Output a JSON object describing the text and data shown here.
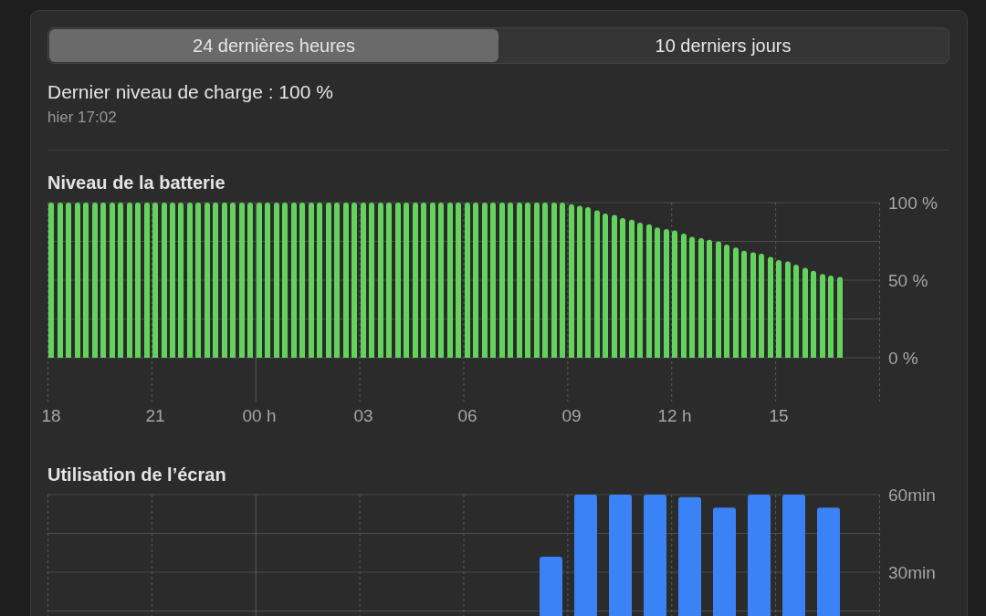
{
  "tabs": [
    {
      "label": "24 dernières heures",
      "selected": true
    },
    {
      "label": "10 derniers jours",
      "selected": false
    }
  ],
  "last_charge": {
    "text": "Dernier niveau de charge : 100 %",
    "time": "hier 17:02"
  },
  "battery": {
    "chart_data": {
      "type": "bar",
      "title": "Niveau de la batterie",
      "ylim": [
        0,
        100
      ],
      "categories": [
        "18",
        null,
        null,
        null,
        null,
        null,
        null,
        null,
        null,
        null,
        null,
        null,
        "21",
        null,
        null,
        null,
        null,
        null,
        null,
        null,
        null,
        null,
        null,
        null,
        "00 h",
        null,
        null,
        null,
        null,
        null,
        null,
        null,
        null,
        null,
        null,
        null,
        "03",
        null,
        null,
        null,
        null,
        null,
        null,
        null,
        null,
        null,
        null,
        null,
        "06",
        null,
        null,
        null,
        null,
        null,
        null,
        null,
        null,
        null,
        null,
        null,
        "09",
        null,
        null,
        null,
        null,
        null,
        null,
        null,
        null,
        null,
        null,
        null,
        "12 h",
        null,
        null,
        null,
        null,
        null,
        null,
        null,
        null,
        null,
        null,
        null,
        "15",
        null,
        null,
        null,
        null,
        null,
        null,
        null
      ],
      "series": [
        {
          "color": "#64d35e",
          "values": [
            100,
            100,
            100,
            100,
            100,
            100,
            100,
            100,
            100,
            100,
            100,
            100,
            100,
            100,
            100,
            100,
            100,
            100,
            100,
            100,
            100,
            100,
            100,
            100,
            100,
            100,
            100,
            100,
            100,
            100,
            100,
            100,
            100,
            100,
            100,
            100,
            100,
            100,
            100,
            100,
            100,
            100,
            100,
            100,
            100,
            100,
            100,
            100,
            100,
            100,
            100,
            100,
            100,
            100,
            100,
            100,
            100,
            100,
            100,
            100,
            99,
            98,
            97,
            95,
            93,
            92,
            90,
            89,
            87,
            86,
            84,
            83,
            82,
            80,
            78,
            77,
            76,
            75,
            73,
            71,
            69,
            68,
            67,
            65,
            63,
            62,
            60,
            58,
            56,
            54,
            53,
            52
          ]
        }
      ],
      "yticks": [
        {
          "value": 0,
          "label": "0 %"
        },
        {
          "value": 50,
          "label": "50 %"
        },
        {
          "value": 100,
          "label": "100 %"
        }
      ]
    }
  },
  "screen": {
    "chart_data": {
      "type": "bar",
      "title": "Utilisation de l’écran",
      "ylim": [
        0,
        60
      ],
      "categories": [
        null,
        null,
        null,
        null,
        null,
        null,
        null,
        null,
        null,
        null,
        null,
        null,
        null,
        null,
        null,
        null,
        null,
        null,
        null,
        null,
        null,
        null,
        null,
        null
      ],
      "series": [
        {
          "color": "#3b82f6",
          "values": [
            0,
            0,
            0,
            0,
            0,
            0,
            0,
            0,
            0,
            0,
            0,
            0,
            0,
            0,
            36,
            60,
            60,
            60,
            59,
            55,
            60,
            60,
            55,
            0
          ]
        }
      ],
      "yticks": [
        {
          "value": 30,
          "label": "30min"
        },
        {
          "value": 60,
          "label": "60min"
        }
      ]
    }
  }
}
